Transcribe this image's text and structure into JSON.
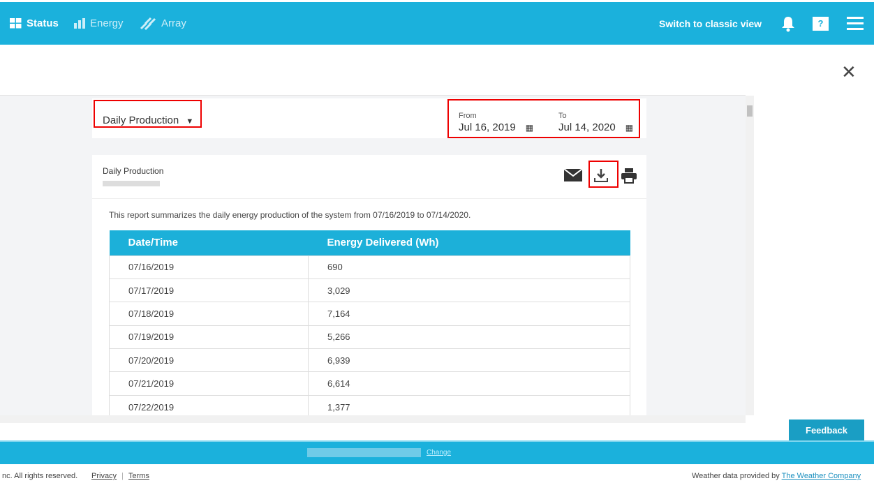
{
  "nav": {
    "status": "Status",
    "energy": "Energy",
    "array": "Array",
    "classic": "Switch to classic view",
    "help": "?"
  },
  "report_selector": {
    "value": "Daily Production"
  },
  "dates": {
    "from_label": "From",
    "from_value": "Jul 16, 2019",
    "to_label": "To",
    "to_value": "Jul 14, 2020"
  },
  "report": {
    "title": "Daily Production",
    "description": "This report summarizes the daily energy production of the system from 07/16/2019 to 07/14/2020.",
    "columns": [
      "Date/Time",
      "Energy Delivered (Wh)"
    ],
    "rows": [
      [
        "07/16/2019",
        "690"
      ],
      [
        "07/17/2019",
        "3,029"
      ],
      [
        "07/18/2019",
        "7,164"
      ],
      [
        "07/19/2019",
        "5,266"
      ],
      [
        "07/20/2019",
        "6,939"
      ],
      [
        "07/21/2019",
        "6,614"
      ],
      [
        "07/22/2019",
        "1,377"
      ]
    ]
  },
  "feedback": "Feedback",
  "footer": {
    "change": "Change",
    "copyright": "nc. All rights reserved.",
    "privacy": "Privacy",
    "terms": "Terms",
    "weather": "Weather data provided by",
    "weather_link": "The Weather Company"
  }
}
